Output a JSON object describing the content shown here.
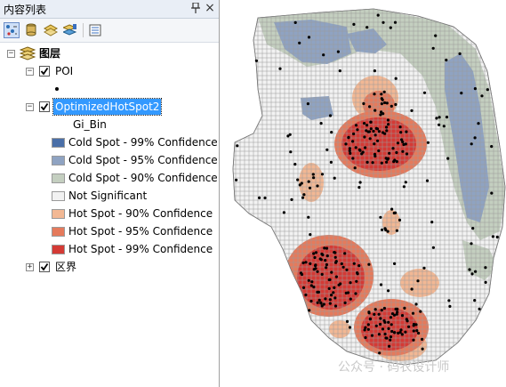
{
  "toc": {
    "title": "内容列表",
    "pin_icon": "pin-icon",
    "close_label": "×",
    "tools": [
      "list-by-drawing-order-icon",
      "list-by-source-icon",
      "list-by-visibility-icon",
      "list-by-selection-icon",
      "options-icon"
    ]
  },
  "tree": {
    "root_label": "图层",
    "layers": [
      {
        "name": "POI",
        "checked": true,
        "expanded": true
      },
      {
        "name": "OptimizedHotSpot2",
        "checked": true,
        "expanded": true,
        "field": "Gi_Bin"
      },
      {
        "name": "区界",
        "checked": true,
        "expanded": false
      }
    ]
  },
  "legend": [
    {
      "label": "Cold Spot - 99% Confidence",
      "color": "#4a6fa8"
    },
    {
      "label": "Cold Spot - 95% Confidence",
      "color": "#8fa3c2"
    },
    {
      "label": "Cold Spot - 90% Confidence",
      "color": "#c4cfc0"
    },
    {
      "label": "Not Significant",
      "color": "#f2f2f2"
    },
    {
      "label": "Hot Spot - 90% Confidence",
      "color": "#f2b894"
    },
    {
      "label": "Hot Spot - 95% Confidence",
      "color": "#e57a5c"
    },
    {
      "label": "Hot Spot - 99% Confidence",
      "color": "#d43a35"
    }
  ],
  "watermark": "公众号 · 码农设计师"
}
